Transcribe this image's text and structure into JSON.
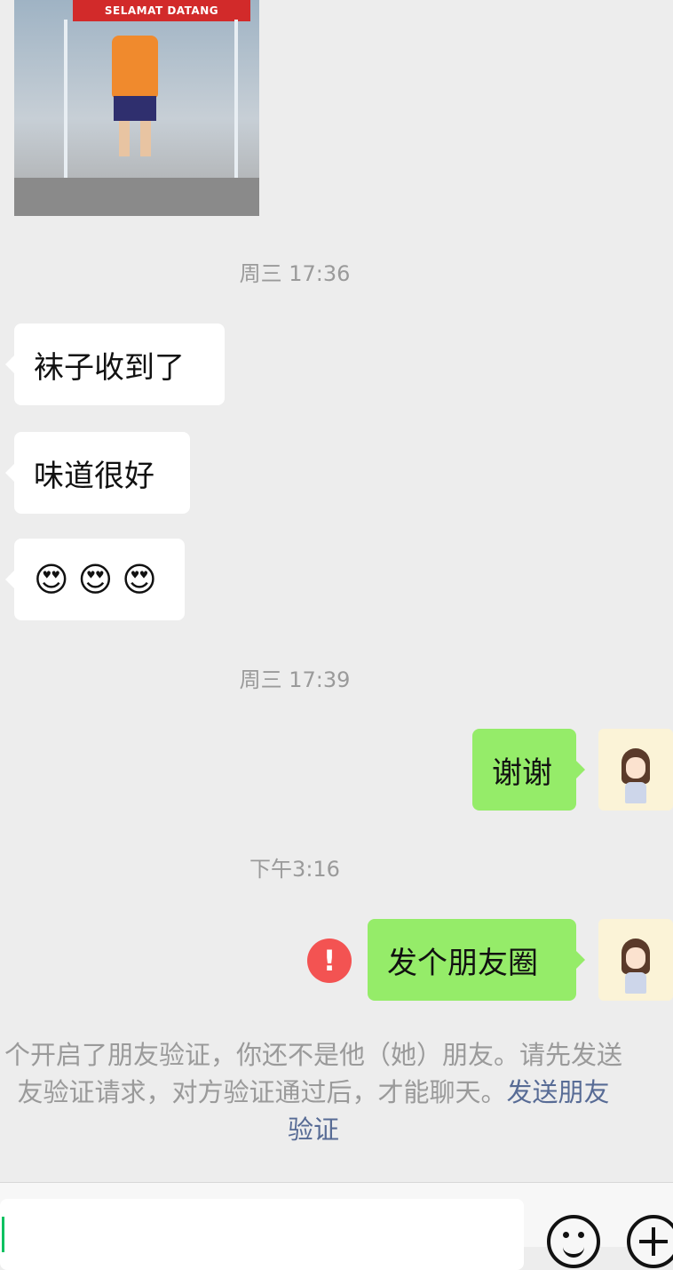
{
  "chat": {
    "photo": {
      "sign_text": "SELAMAT DATANG"
    },
    "timestamps": [
      "周三 17:36",
      "周三 17:39",
      "下午3:16"
    ],
    "incoming": {
      "msg1": "袜子收到了",
      "msg2": "味道很好",
      "emojis": [
        "😍",
        "😍",
        "😍"
      ]
    },
    "outgoing": {
      "msg1": "谢谢",
      "msg2": "发个朋友圈",
      "failed_icon": "!"
    },
    "system_notice": {
      "line1": "个开启了朋友验证，你还不是他（她）朋友。请先发送",
      "line2_text": "友验证请求，对方验证通过后，才能聊天。",
      "line2_link": "发送朋友",
      "line3_link": "验证"
    }
  },
  "input_bar": {
    "emoji_icon": "smiley-icon",
    "more_icon": "plus-icon"
  },
  "colors": {
    "background": "#ededed",
    "outgoing_bubble": "#95ec69",
    "incoming_bubble": "#ffffff",
    "error": "#f35352",
    "link": "#576b95"
  }
}
